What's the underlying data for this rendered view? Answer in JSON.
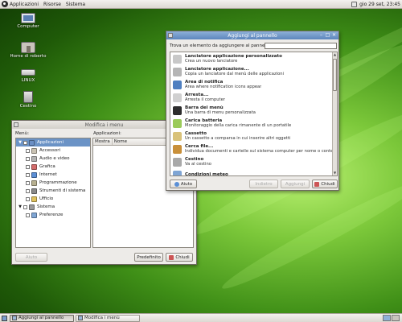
{
  "top_panel": {
    "menus": [
      "Applicazioni",
      "Risorse",
      "Sistema"
    ],
    "clock": "gio 29 set, 23:45"
  },
  "desktop_icons": [
    {
      "label": "Computer",
      "icon": "computer-icon"
    },
    {
      "label": "Home di roberto",
      "icon": "home-folder-icon"
    },
    {
      "label": "LINUX",
      "icon": "drive-icon"
    },
    {
      "label": "Cestino",
      "icon": "trash-icon"
    }
  ],
  "menu_editor": {
    "title": "Modifica i menu",
    "menus_label": "Menù:",
    "apps_label": "Applicazioni:",
    "columns": [
      "Mostra",
      "Nome"
    ],
    "tree": [
      {
        "label": "Applicazioni",
        "level": 0,
        "selected": true,
        "color": "#6a8fc5"
      },
      {
        "label": "Accessori",
        "level": 1,
        "color": "#c9c2b3"
      },
      {
        "label": "Audio e video",
        "level": 1,
        "color": "#b3b3b3"
      },
      {
        "label": "Grafica",
        "level": 1,
        "color": "#d36b6b"
      },
      {
        "label": "Internet",
        "level": 1,
        "color": "#5b8fd6"
      },
      {
        "label": "Programmazione",
        "level": 1,
        "color": "#b7b090"
      },
      {
        "label": "Strumenti di sistema",
        "level": 1,
        "color": "#8a8a8a"
      },
      {
        "label": "Ufficio",
        "level": 1,
        "color": "#e0c25e"
      },
      {
        "label": "Sistema",
        "level": 0,
        "color": "#9b9b9b"
      },
      {
        "label": "Preferenze",
        "level": 1,
        "color": "#7fa5d4"
      }
    ],
    "btn_help": "Aiuto",
    "btn_default": "Predefinito",
    "btn_close": "Chiudi"
  },
  "add_panel": {
    "title": "Aggiungi al pannello",
    "search_label": "Trova un elemento da aggiungere al pannello:",
    "search_value": "",
    "items": [
      {
        "title": "Lanciatore applicazione personalizzato",
        "desc": "Crea un nuovo lanciatore",
        "icon": "launcher-icon",
        "color": "#c8c8c8"
      },
      {
        "title": "Lanciatore applicazione...",
        "desc": "Copia un lanciatore dal menù delle applicazioni",
        "icon": "launcher-copy-icon",
        "color": "#b5b5b5"
      },
      {
        "title": "Area di notifica",
        "desc": "Area where notification icons appear",
        "icon": "info-icon",
        "color": "#4f7fc0"
      },
      {
        "title": "Arresta...",
        "desc": "Arresta il computer",
        "icon": "shutdown-icon",
        "color": "#d0d0d0"
      },
      {
        "title": "Barra dei menù",
        "desc": "Una barra di menu personalizzata",
        "icon": "foot-icon",
        "color": "#2d2d2d"
      },
      {
        "title": "Carica batteria",
        "desc": "Monitoraggio della carica rimanente di un portatile",
        "icon": "battery-icon",
        "color": "#9bcb5a"
      },
      {
        "title": "Cassetto",
        "desc": "Un cassetto a comparsa in cui inserire altri oggetti",
        "icon": "drawer-icon",
        "color": "#d9c27a"
      },
      {
        "title": "Cerca file...",
        "desc": "Individua documenti e cartelle sul sistema computer per nome o conten...",
        "icon": "search-file-icon",
        "color": "#c9903a"
      },
      {
        "title": "Cestino",
        "desc": "Va al cestino",
        "icon": "trash-icon",
        "color": "#a9a9a9"
      },
      {
        "title": "Condizioni meteo",
        "desc": "",
        "icon": "weather-icon",
        "color": "#7fa5d4"
      }
    ],
    "btn_help": "Aiuto",
    "btn_back": "Indietro",
    "btn_add": "Aggiungi",
    "btn_close": "Chiudi"
  },
  "bottom_panel": {
    "tasks": [
      {
        "label": "Aggiungi al pannello",
        "active": true
      },
      {
        "label": "Modifica i menù",
        "active": false
      }
    ]
  }
}
